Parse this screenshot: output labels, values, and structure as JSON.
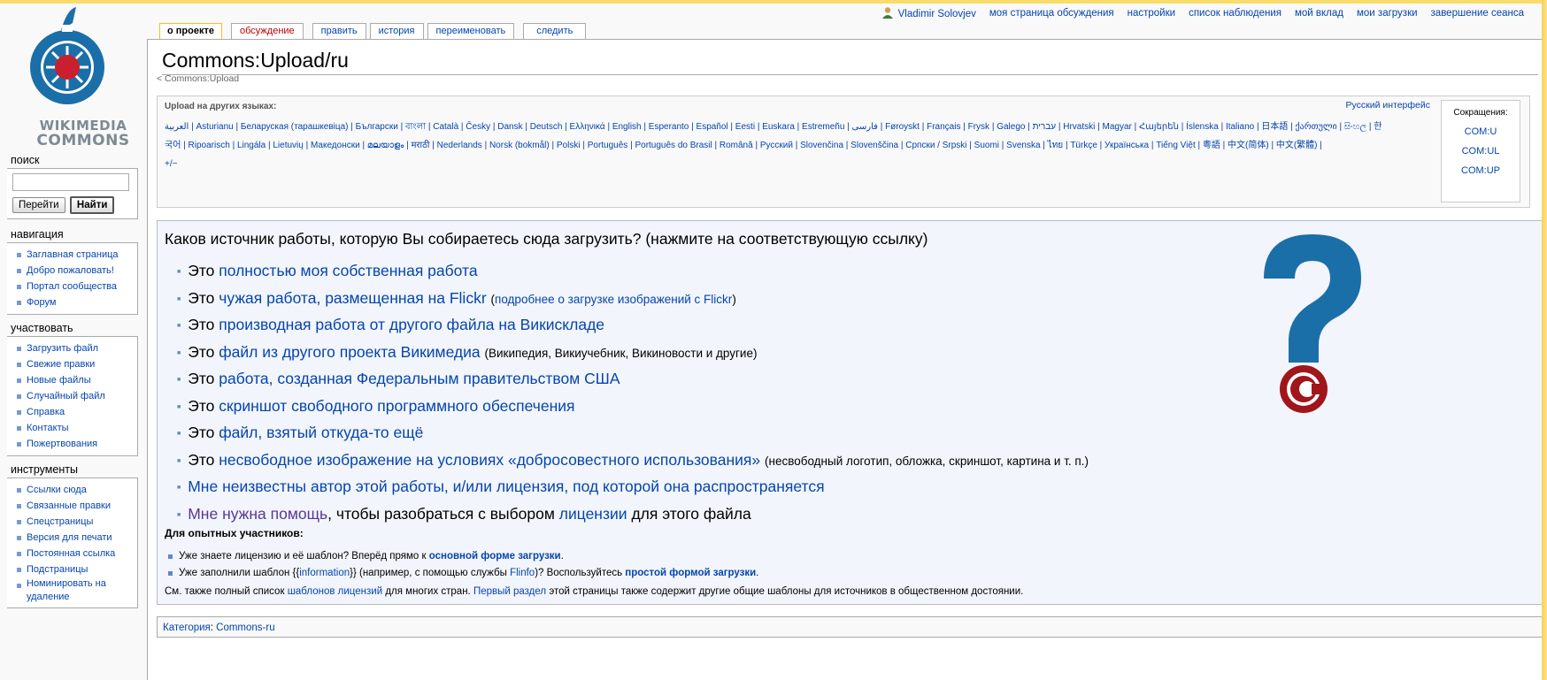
{
  "logo": {
    "line1": "WIKIMEDIA",
    "line2": "COMMONS"
  },
  "personal": {
    "user": "Vladimir Solovjev",
    "links": [
      "моя страница обсуждения",
      "настройки",
      "список наблюдения",
      "мой вклад",
      "мои загрузки",
      "завершение сеанса"
    ]
  },
  "tabs": {
    "project": "о проекте",
    "discussion": "обсуждение",
    "edit": "править",
    "history": "история",
    "rename": "переименовать",
    "watch": "следить"
  },
  "page": {
    "title": "Commons:Upload/ru",
    "subpage": "< Commons:Upload"
  },
  "sidebar": {
    "search_title": "поиск",
    "go_button": "Перейти",
    "search_button": "Найти",
    "nav_title": "навигация",
    "nav_items": [
      "Заглавная страница",
      "Добро пожаловать!",
      "Портал сообщества",
      "Форум"
    ],
    "participate_title": "участвовать",
    "participate_items": [
      "Загрузить файл",
      "Свежие правки",
      "Новые файлы",
      "Случайный файл",
      "Справка",
      "Контакты",
      "Пожертвования"
    ],
    "tools_title": "инструменты",
    "tools_items": [
      "Ссылки сюда",
      "Связанные правки",
      "Спецстраницы",
      "Версия для печати",
      "Постоянная ссылка",
      "Подстраницы",
      "Номинировать на",
      "удаление"
    ]
  },
  "languages": {
    "heading": "Upload на других языках:",
    "interface_link": "Русский интерфейс",
    "line1": "العربية | Asturianu | Беларуская (тарашкевіца) | Български | বাংলা | Català | Česky | Dansk | Deutsch | Ελληνικά | English | Esperanto | Español | Eesti | Euskara | Estremeñu | فارسی | Føroyskt | Français | Frysk | Galego | עברית | Hrvatski | Magyar | Հայերեն | Íslenska | Italiano | 日本語 | ქართული | සිංහල | 한",
    "line2": "국어 | Ripoarisch | Lingála | Lietuvių | Македонски | മലയാളം | मराठी | Nederlands | Norsk (bokmål) | Polski | Português | Português do Brasil | Română | Русский | Slovenčina | Slovenščina | Српски / Srpski | Suomi | Svenska | ไทย | Türkçe | Українська | Tiếng Việt | 粵語 | 中文(简体) | 中文(繁體) |",
    "line3": "+/−",
    "shortcuts_title": "Сокращения:",
    "shortcuts": [
      "COM:U",
      "COM:UL",
      "COM:UP"
    ]
  },
  "upload": {
    "question": "Каков источник работы, которую Вы собираетесь сюда загрузить? (нажмите на соответствующую ссылку)",
    "prefix": "Это",
    "opt1": "полностью моя собственная работа",
    "opt2": "чужая работа, размещенная на Flickr",
    "opt2_note": "подробнее о загрузке изображений с Flickr",
    "opt3": "производная работа от другого файла на Викискладе",
    "opt4": "файл из другого проекта Викимедиа",
    "opt4_note": "(Википедия, Викиучебник, Викиновости и другие)",
    "opt5": "работа, созданная Федеральным правительством США",
    "opt6": "скриншот свободного программного обеспечения",
    "opt7": "файл, взятый откуда-то ещё",
    "opt8": "несвободное изображение на условиях «добросовестного использования»",
    "opt8_note": "(несвободный логотип, обложка, скриншот, картина и т. п.)",
    "opt9": "Мне неизвестны автор этой работы, и/или лицензия, под которой она распространяется",
    "opt10_link": "Мне нужна помощь",
    "opt10_mid": ", чтобы разобраться с выбором",
    "opt10_link2": "лицензии",
    "opt10_end": "для этого файла",
    "exp_title": "Для опытных участников:",
    "exp1_text": "Уже знаете лицензию и её шаблон? Вперёд прямо к",
    "exp1_link": "основной форме загрузки",
    "exp2_a": "Уже заполнили шаблон {{",
    "exp2_info": "information",
    "exp2_b": "}} (например, с помощью службы",
    "exp2_flinfo": "Flinfo",
    "exp2_c": ")? Воспользуйтесь",
    "exp2_link": "простой формой загрузки",
    "see_a": "См. также полный список",
    "see_link1": "шаблонов лицензий",
    "see_b": "для многих стран.",
    "see_link2": "Первый раздел",
    "see_c": "этой страницы также содержит другие общие шаблоны для источников в общественном достоянии."
  },
  "category": {
    "label": "Категория",
    "value": "Commons-ru"
  },
  "colors": {
    "link": "#0645ad",
    "question_blue": "#1b6fa8",
    "copyright_red": "#a0161b"
  }
}
